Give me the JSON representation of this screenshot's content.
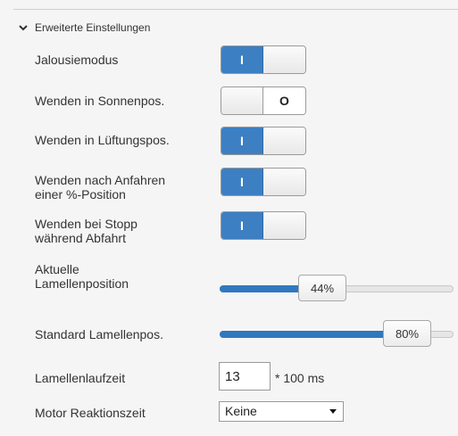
{
  "section": {
    "title": "Erweiterte Einstellungen",
    "expanded_icon": "chevron-down-icon"
  },
  "toggles": [
    {
      "label": "Jalousiemodus",
      "state": "on",
      "on_glyph": "I",
      "off_glyph": "O"
    },
    {
      "label": "Wenden in Sonnenpos.",
      "state": "off",
      "on_glyph": "I",
      "off_glyph": "O"
    },
    {
      "label": "Wenden in Lüftungspos.",
      "state": "on",
      "on_glyph": "I",
      "off_glyph": "O"
    },
    {
      "label": "Wenden nach Anfahren\neiner %-Position",
      "state": "on",
      "on_glyph": "I",
      "off_glyph": "O"
    },
    {
      "label": "Wenden bei Stopp\nwährend Abfahrt",
      "state": "on",
      "on_glyph": "I",
      "off_glyph": "O"
    }
  ],
  "sliders": [
    {
      "label": "Aktuelle\nLamellenposition",
      "value_text": "44%",
      "value": 44
    },
    {
      "label": "Standard Lamellenpos.",
      "value_text": "80%",
      "value": 80
    }
  ],
  "runtime": {
    "label": "Lamellenlaufzeit",
    "value": "13",
    "unit": "* 100 ms"
  },
  "motor": {
    "label": "Motor Reaktionszeit",
    "selected": "Keine"
  },
  "colors": {
    "accent": "#3c7fc2",
    "panel_bg": "#f5f5f5"
  }
}
